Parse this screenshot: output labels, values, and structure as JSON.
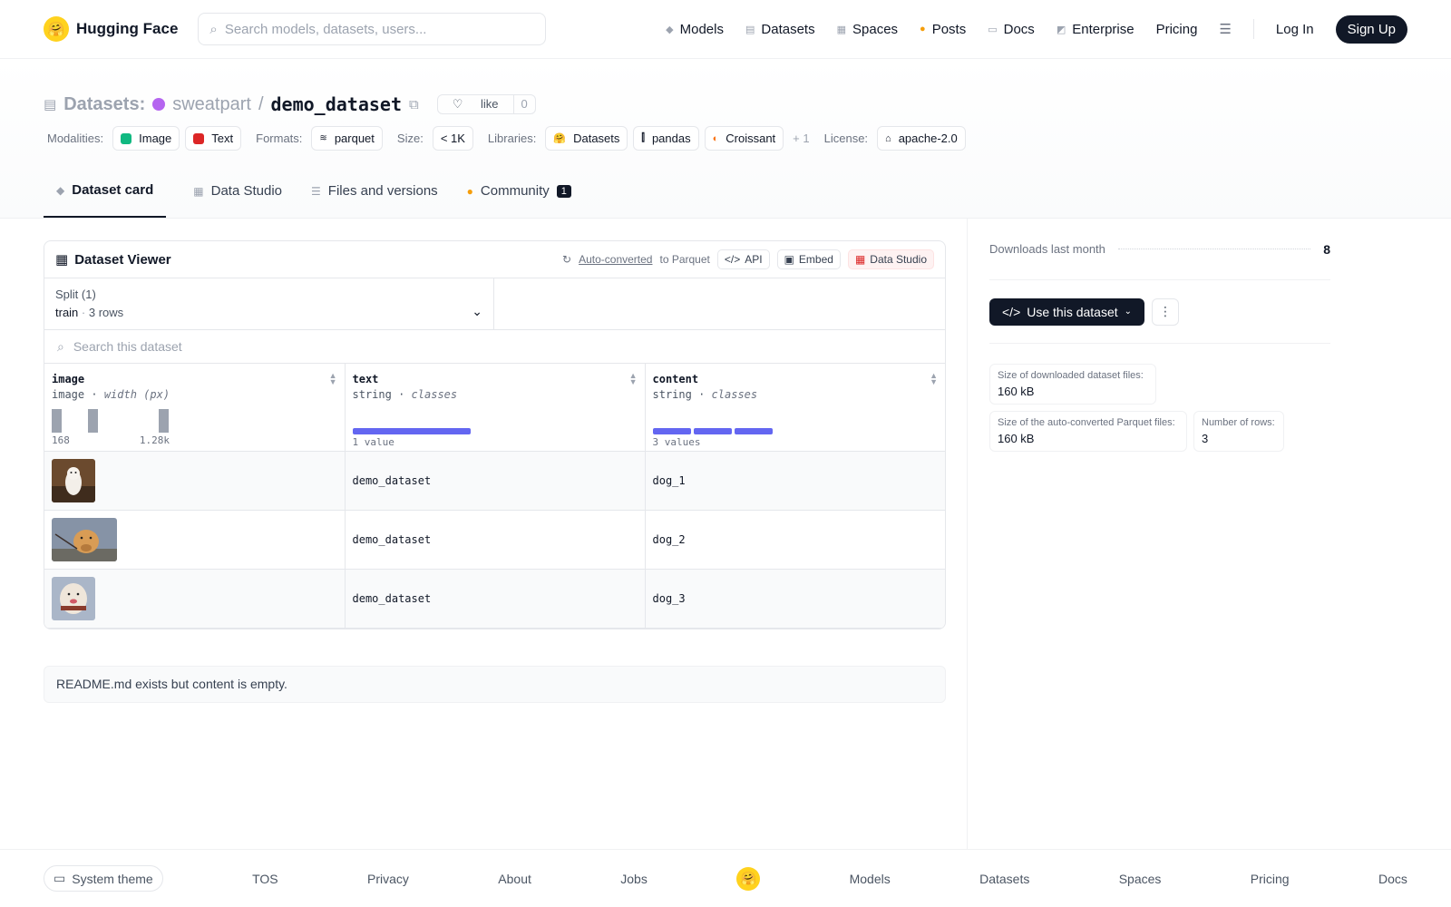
{
  "nav": {
    "brand": "Hugging Face",
    "search_placeholder": "Search models, datasets, users...",
    "links": [
      {
        "label": "Models",
        "icon": "cube-icon"
      },
      {
        "label": "Datasets",
        "icon": "database-icon"
      },
      {
        "label": "Spaces",
        "icon": "grid-icon"
      },
      {
        "label": "Posts",
        "icon": "chat-icon"
      },
      {
        "label": "Docs",
        "icon": "book-icon"
      },
      {
        "label": "Enterprise",
        "icon": "rocket-icon"
      },
      {
        "label": "Pricing"
      }
    ],
    "login": "Log In",
    "signup": "Sign Up"
  },
  "header": {
    "section": "Datasets:",
    "org": "sweatpart",
    "separator": "/",
    "dataset": "demo_dataset",
    "like_label": "like",
    "like_count": "0",
    "modalities_label": "Modalities:",
    "modalities": [
      "Image",
      "Text"
    ],
    "formats_label": "Formats:",
    "formats": [
      "parquet"
    ],
    "size_label": "Size:",
    "size": "< 1K",
    "libraries_label": "Libraries:",
    "libraries": [
      "Datasets",
      "pandas",
      "Croissant"
    ],
    "libraries_more": "+ 1",
    "license_label": "License:",
    "license": "apache-2.0"
  },
  "tabs": [
    {
      "label": "Dataset card",
      "active": true
    },
    {
      "label": "Data Studio"
    },
    {
      "label": "Files and versions"
    },
    {
      "label": "Community",
      "badge": "1"
    }
  ],
  "viewer": {
    "title": "Dataset Viewer",
    "auto_converted": "Auto-converted",
    "to_parquet": "to Parquet",
    "api": "API",
    "embed": "Embed",
    "data_studio": "Data Studio",
    "split_label": "Split (1)",
    "split_name": "train",
    "split_dot": "·",
    "split_rows": "3 rows",
    "search_placeholder": "Search this dataset",
    "columns": [
      {
        "name": "image",
        "type": "image",
        "sub": "width (px)",
        "min": "168",
        "max": "1.28k"
      },
      {
        "name": "text",
        "type": "string",
        "sub": "classes",
        "note": "1 value"
      },
      {
        "name": "content",
        "type": "string",
        "sub": "classes",
        "note": "3 values"
      }
    ],
    "rows": [
      {
        "text": "demo_dataset",
        "content": "dog_1"
      },
      {
        "text": "demo_dataset",
        "content": "dog_2"
      },
      {
        "text": "demo_dataset",
        "content": "dog_3"
      }
    ]
  },
  "readme_note": "README.md exists but content is empty.",
  "sidebar": {
    "downloads_label": "Downloads last month",
    "downloads": "8",
    "use_button": "Use this dataset",
    "stats": [
      {
        "label": "Size of downloaded dataset files:",
        "value": "160 kB"
      },
      {
        "label": "Size of the auto-converted Parquet files:",
        "value": "160 kB"
      },
      {
        "label": "Number of rows:",
        "value": "3"
      }
    ]
  },
  "footer": {
    "theme": "System theme",
    "links": [
      "TOS",
      "Privacy",
      "About",
      "Jobs",
      "Models",
      "Datasets",
      "Spaces",
      "Pricing",
      "Docs"
    ]
  }
}
